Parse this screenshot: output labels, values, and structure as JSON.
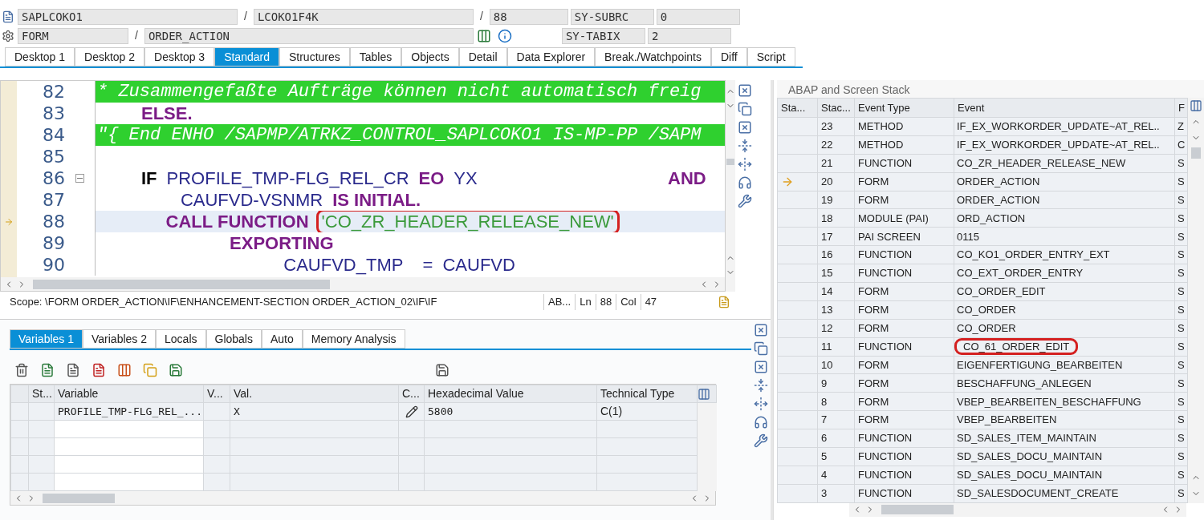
{
  "header": {
    "separators": [
      "/",
      "/",
      "/"
    ],
    "program": "SAPLCOKO1",
    "include": "LCOKO1F4K",
    "line": "88",
    "event_type": "FORM",
    "event": "ORDER_ACTION",
    "sys_fields": [
      {
        "name": "SY-SUBRC",
        "value": "0"
      },
      {
        "name": "SY-TABIX",
        "value": "2"
      }
    ]
  },
  "main_tabs": [
    {
      "label": "Desktop 1",
      "selected": false
    },
    {
      "label": "Desktop 2",
      "selected": false
    },
    {
      "label": "Desktop 3",
      "selected": false
    },
    {
      "label": "Standard",
      "selected": true
    },
    {
      "label": "Structures",
      "selected": false
    },
    {
      "label": "Tables",
      "selected": false
    },
    {
      "label": "Objects",
      "selected": false
    },
    {
      "label": "Detail",
      "selected": false
    },
    {
      "label": "Data Explorer",
      "selected": false
    },
    {
      "label": "Break./Watchpoints",
      "selected": false
    },
    {
      "label": "Diff",
      "selected": false
    },
    {
      "label": "Script",
      "selected": false
    }
  ],
  "editor": {
    "lines": [
      {
        "number": "82",
        "kind": "comment",
        "current": false,
        "fold": false,
        "tokens": [
          {
            "text": "* Zusammengefaßte Aufträge können nicht automatisch freig",
            "kind": "comment",
            "boxed": false
          }
        ]
      },
      {
        "number": "83",
        "kind": "code",
        "current": false,
        "fold": false,
        "tokens": [
          {
            "text": "         ELSE.",
            "kind": "keyword",
            "boxed": false
          }
        ]
      },
      {
        "number": "84",
        "kind": "comment",
        "current": false,
        "fold": false,
        "tokens": [
          {
            "text": "\"{ End ENHO /SAPMP/ATRKZ_CONTROL_SAPLCOKO1 IS-MP-PP /SAPM",
            "kind": "comment",
            "boxed": false
          }
        ]
      },
      {
        "number": "85",
        "kind": "code",
        "current": false,
        "fold": false
      },
      {
        "number": "86",
        "kind": "code",
        "current": false,
        "fold": true,
        "tokens": [
          {
            "text": "         IF",
            "kind": "control",
            "boxed": false
          },
          {
            "text": "PROFILE_TMP-FLG_REL_CR",
            "kind": "name",
            "boxed": false
          },
          {
            "text": "EO",
            "kind": "keyword",
            "boxed": false
          },
          {
            "text": "YX",
            "kind": "name",
            "boxed": false
          },
          {
            "text": "                                     AND",
            "kind": "keyword",
            "boxed": false
          }
        ]
      },
      {
        "number": "87",
        "kind": "code",
        "current": false,
        "fold": false,
        "tokens": [
          {
            "text": "                 CAUFVD-VSNMR",
            "kind": "name",
            "boxed": false
          },
          {
            "text": "IS INITIAL.",
            "kind": "keyword",
            "boxed": false
          }
        ]
      },
      {
        "number": "88",
        "kind": "code",
        "current": true,
        "fold": false,
        "tokens": [
          {
            "text": "              CALL FUNCTION",
            "kind": "keyword",
            "boxed": false
          },
          {
            "text": "'CO_ZR_HEADER_RELEASE_NEW'",
            "kind": "string",
            "boxed": true
          }
        ]
      },
      {
        "number": "89",
        "kind": "code",
        "current": false,
        "fold": false,
        "tokens": [
          {
            "text": "                           EXPORTING",
            "kind": "keyword",
            "boxed": false
          }
        ]
      },
      {
        "number": "90",
        "kind": "code",
        "current": false,
        "fold": false,
        "tokens": [
          {
            "text": "                                      CAUFVD_TMP",
            "kind": "name",
            "boxed": false
          },
          {
            "text": "  =",
            "kind": "name",
            "boxed": false
          },
          {
            "text": "CAUFVD",
            "kind": "name",
            "boxed": false
          }
        ]
      }
    ],
    "scope": "Scope: \\FORM ORDER_ACTION\\IF\\ENHANCEMENT-SECTION ORDER_ACTION_02\\IF\\IF",
    "status": [
      "AB...",
      "Ln",
      "88",
      "Col",
      "47"
    ]
  },
  "variables": {
    "tabs": [
      {
        "label": "Variables 1",
        "selected": true
      },
      {
        "label": "Variables 2",
        "selected": false
      },
      {
        "label": "Locals",
        "selected": false
      },
      {
        "label": "Globals",
        "selected": false
      },
      {
        "label": "Auto",
        "selected": false
      },
      {
        "label": "Memory Analysis",
        "selected": false
      }
    ],
    "columns": [
      "St...",
      "Variable",
      "V...",
      "Val.",
      "C...",
      "Hexadecimal Value",
      "Technical Type"
    ],
    "rows": [
      {
        "variable": "PROFILE_TMP-FLG_REL_...",
        "value": "X",
        "editable": true,
        "hex": "5800",
        "type": "C(1)"
      }
    ]
  },
  "stack": {
    "title": "ABAP and Screen Stack",
    "columns": [
      "Sta...",
      "Stac...",
      "Event Type",
      "Event",
      "F"
    ],
    "rows": [
      {
        "level": "23",
        "type": "METHOD",
        "event": "IF_EX_WORKORDER_UPDATE~AT_REL..",
        "column_5": "Z",
        "current": false,
        "boxed": false
      },
      {
        "level": "22",
        "type": "METHOD",
        "event": "IF_EX_WORKORDER_UPDATE~AT_REL..",
        "column_5": "C",
        "current": false,
        "boxed": false
      },
      {
        "level": "21",
        "type": "FUNCTION",
        "event": "CO_ZR_HEADER_RELEASE_NEW",
        "column_5": "S",
        "current": false,
        "boxed": false
      },
      {
        "level": "20",
        "type": "FORM",
        "event": "ORDER_ACTION",
        "column_5": "S",
        "current": true,
        "boxed": false
      },
      {
        "level": "19",
        "type": "FORM",
        "event": "ORDER_ACTION",
        "column_5": "S",
        "current": false,
        "boxed": false
      },
      {
        "level": "18",
        "type": "MODULE (PAI)",
        "event": "ORD_ACTION",
        "column_5": "S",
        "current": false,
        "boxed": false
      },
      {
        "level": "17",
        "type": "PAI SCREEN",
        "event": "0115",
        "column_5": "S",
        "current": false,
        "boxed": false
      },
      {
        "level": "16",
        "type": "FUNCTION",
        "event": "CO_KO1_ORDER_ENTRY_EXT",
        "column_5": "S",
        "current": false,
        "boxed": false
      },
      {
        "level": "15",
        "type": "FUNCTION",
        "event": "CO_EXT_ORDER_ENTRY",
        "column_5": "S",
        "current": false,
        "boxed": false
      },
      {
        "level": "14",
        "type": "FORM",
        "event": "CO_ORDER_EDIT",
        "column_5": "S",
        "current": false,
        "boxed": false
      },
      {
        "level": "13",
        "type": "FORM",
        "event": "CO_ORDER",
        "column_5": "S",
        "current": false,
        "boxed": false
      },
      {
        "level": "12",
        "type": "FORM",
        "event": "CO_ORDER",
        "column_5": "S",
        "current": false,
        "boxed": false
      },
      {
        "level": "11",
        "type": "FUNCTION",
        "event": "CO_61_ORDER_EDIT",
        "column_5": "S",
        "current": false,
        "boxed": true
      },
      {
        "level": "10",
        "type": "FORM",
        "event": "EIGENFERTIGUNG_BEARBEITEN",
        "column_5": "S",
        "current": false,
        "boxed": false
      },
      {
        "level": "9",
        "type": "FORM",
        "event": "BESCHAFFUNG_ANLEGEN",
        "column_5": "S",
        "current": false,
        "boxed": false
      },
      {
        "level": "8",
        "type": "FORM",
        "event": "VBEP_BEARBEITEN_BESCHAFFUNG",
        "column_5": "S",
        "current": false,
        "boxed": false
      },
      {
        "level": "7",
        "type": "FORM",
        "event": "VBEP_BEARBEITEN",
        "column_5": "S",
        "current": false,
        "boxed": false
      },
      {
        "level": "6",
        "type": "FUNCTION",
        "event": "SD_SALES_ITEM_MAINTAIN",
        "column_5": "S",
        "current": false,
        "boxed": false
      },
      {
        "level": "5",
        "type": "FUNCTION",
        "event": "SD_SALES_DOCU_MAINTAIN",
        "column_5": "S",
        "current": false,
        "boxed": false
      },
      {
        "level": "4",
        "type": "FUNCTION",
        "event": "SD_SALES_DOCU_MAINTAIN",
        "column_5": "S",
        "current": false,
        "boxed": false
      },
      {
        "level": "3",
        "type": "FUNCTION",
        "event": "SD_SALESDOCUMENT_CREATE",
        "column_5": "S",
        "current": false,
        "boxed": false
      }
    ]
  }
}
